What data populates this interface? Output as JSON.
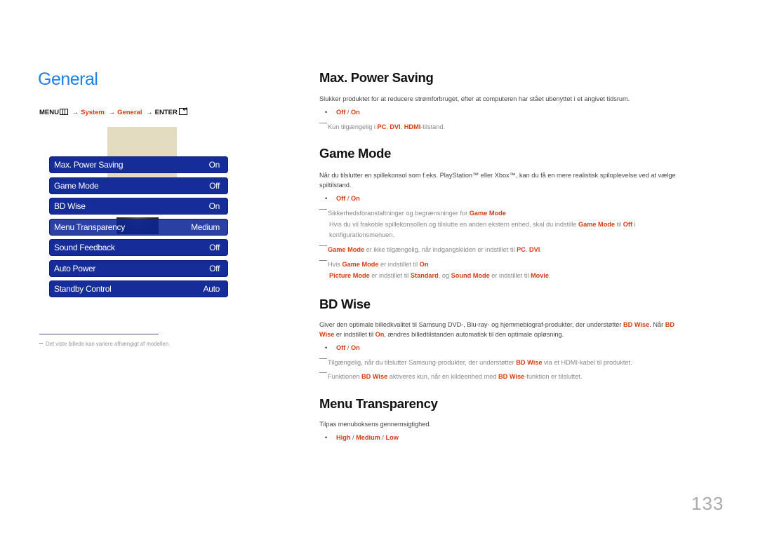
{
  "page": {
    "title": "General",
    "number": "133"
  },
  "menu_path": {
    "menu": "MENU",
    "menu_icon": "menu-grid-icon",
    "arrow": "→",
    "system": "System",
    "general": "General",
    "enter": "ENTER",
    "enter_icon": "enter-icon"
  },
  "osd_menu": {
    "items": [
      {
        "label": "Max. Power Saving",
        "value": "On"
      },
      {
        "label": "Game Mode",
        "value": "Off"
      },
      {
        "label": "BD Wise",
        "value": "On"
      },
      {
        "label": "Menu Transparency",
        "value": "Medium"
      },
      {
        "label": "Sound Feedback",
        "value": "Off"
      },
      {
        "label": "Auto Power",
        "value": "Off"
      },
      {
        "label": "Standby Control",
        "value": "Auto"
      }
    ]
  },
  "footnote": "Det viste billede kan variere afhængigt af modellen.",
  "sections": {
    "max_power_saving": {
      "title": "Max. Power Saving",
      "desc": "Slukker produktet for at reducere strømforbruget, efter at computeren har stået ubenyttet i et angivet tidsrum.",
      "options": [
        "Off",
        "On"
      ],
      "note": {
        "pre": "Kun tilgængelig i ",
        "pc": "PC",
        "c1": ", ",
        "dvi": "DVI",
        "c2": ", ",
        "hdmi": "HDMI",
        "post": "-tilstand."
      }
    },
    "game_mode": {
      "title": "Game Mode",
      "desc_line1": "Når du tilslutter en spillekonsol som f.eks. PlayStation™ eller Xbox™, kan du få en mere realistisk spiloplevelse ved at vælge",
      "desc_line2": "spiltilstand.",
      "options": [
        "Off",
        "On"
      ],
      "note1": {
        "pre": "Sikkerhedsforanstaltninger og begrænsninger for ",
        "gm": "Game Mode"
      },
      "note1_sub": {
        "pre": "Hvis du vil frakoble spillekonsollen og tilslutte en anden ekstern enhed, skal du indstille ",
        "gm": "Game Mode",
        "mid": " til ",
        "off": "Off",
        "post": " i",
        "line2": "konfigurationsmenuen."
      },
      "note2": {
        "gm": "Game Mode",
        "mid": " er ikke tilgængelig, når indgangskilden er indstillet til ",
        "pc": "PC",
        "c": ", ",
        "dvi": "DVI",
        "post": "."
      },
      "note3": {
        "pre": "Hvis ",
        "gm": "Game Mode",
        "mid": " er indstillet til ",
        "on": "On"
      },
      "note3_sub": {
        "pm": "Picture Mode",
        "t1": " er indstillet til ",
        "std": "Standard",
        "t2": ", og ",
        "sm": "Sound Mode",
        "t3": " er indstillet til ",
        "movie": "Movie",
        "post": "."
      }
    },
    "bd_wise": {
      "title": "BD Wise",
      "desc": {
        "pre": "Giver den optimale billedkvalitet til Samsung DVD-, Blu-ray- og hjemmebiograf-produkter, der understøtter ",
        "bd1": "BD Wise",
        "mid": ". Når ",
        "bd2a": "BD",
        "bd2b": "Wise",
        "t2": " er indstillet til ",
        "on": "On",
        "post": ", ændres billedtilstanden automatisk til den optimale opløsning."
      },
      "options": [
        "Off",
        "On"
      ],
      "note1": {
        "pre": "Tilgængelig, når du tilslutter Samsung-produkter, der understøtter ",
        "bd": "BD Wise",
        "post": " via et HDMI-kabel til produktet."
      },
      "note2": {
        "pre": "Funktionen ",
        "bd1": "BD Wise",
        "mid": " aktiveres kun, når en kildeenhed med ",
        "bd2": "BD Wise",
        "post": "-funktion er tilsluttet."
      }
    },
    "menu_transparency": {
      "title": "Menu Transparency",
      "desc": "Tilpas menuboksens gennemsigtighed.",
      "options": [
        "High",
        "Medium",
        "Low"
      ]
    },
    "option_separator": " / ",
    "bullet": "•"
  },
  "colors": {
    "title_blue": "#1a81e8",
    "highlight_red": "#d43b10",
    "osd_blue": "#0e2696"
  }
}
